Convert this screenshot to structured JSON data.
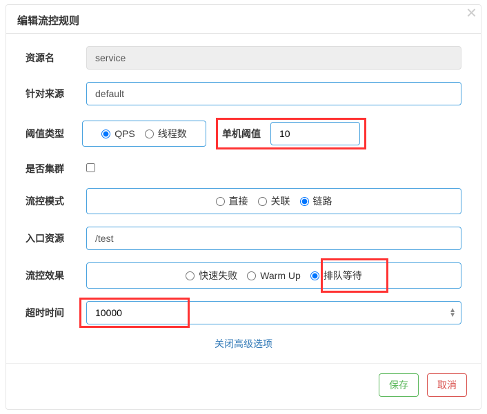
{
  "modal": {
    "title": "编辑流控规则",
    "close_collapse_label": "关闭高级选项"
  },
  "fields": {
    "resource_name": {
      "label": "资源名",
      "value": "service"
    },
    "limit_app": {
      "label": "针对来源",
      "value": "default"
    },
    "threshold_type": {
      "label": "阈值类型",
      "options": {
        "qps": "QPS",
        "threads": "线程数"
      },
      "selected": "qps"
    },
    "threshold_value": {
      "label": "单机阈值",
      "value": "10"
    },
    "is_cluster": {
      "label": "是否集群",
      "checked": false
    },
    "control_mode": {
      "label": "流控模式",
      "options": {
        "direct": "直接",
        "relate": "关联",
        "chain": "链路"
      },
      "selected": "chain"
    },
    "entry_resource": {
      "label": "入口资源",
      "value": "/test"
    },
    "control_effect": {
      "label": "流控效果",
      "options": {
        "fast_fail": "快速失败",
        "warm_up": "Warm Up",
        "queue": "排队等待"
      },
      "selected": "queue"
    },
    "timeout": {
      "label": "超时时间",
      "value": "10000"
    }
  },
  "footer": {
    "save": "保存",
    "cancel": "取消"
  }
}
